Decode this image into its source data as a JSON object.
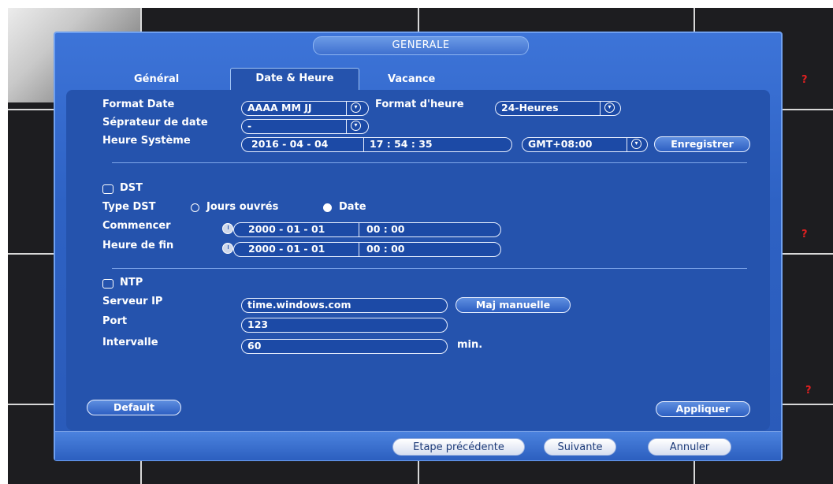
{
  "dialog": {
    "title": "GENERALE"
  },
  "tabs": [
    {
      "label": "Général"
    },
    {
      "label": "Date & Heure"
    },
    {
      "label": "Vacance"
    }
  ],
  "date_format": {
    "label": "Format Date",
    "value": "AAAA MM JJ"
  },
  "time_format": {
    "label": "Format d'heure",
    "value": "24-Heures"
  },
  "date_separator": {
    "label": "Séprateur de date",
    "value": "-"
  },
  "system_time": {
    "label": "Heure Système",
    "date": "2016 - 04 - 04",
    "time": "17 : 54 : 35",
    "timezone": "GMT+08:00",
    "save_label": "Enregistrer"
  },
  "dst": {
    "label": "DST",
    "type_label": "Type DST",
    "option_weekdays": "Jours ouvrés",
    "option_date": "Date",
    "selected": "Date",
    "start_label": "Commencer",
    "start_date": "2000 - 01 - 01",
    "start_time": "00 : 00",
    "end_label": "Heure de fin",
    "end_date": "2000 - 01 - 01",
    "end_time": "00 : 00"
  },
  "ntp": {
    "label": "NTP",
    "server_label": "Serveur IP",
    "server_value": "time.windows.com",
    "manual_update_label": "Maj manuelle",
    "port_label": "Port",
    "port_value": "123",
    "interval_label": "Intervalle",
    "interval_value": "60",
    "interval_unit": "min."
  },
  "actions": {
    "default_label": "Default",
    "apply_label": "Appliquer"
  },
  "footer": {
    "prev_label": "Etape précédente",
    "next_label": "Suivante",
    "cancel_label": "Annuler"
  },
  "background": {
    "help_mark": "?"
  },
  "colors": {
    "dialog_blue": "#2e62c4",
    "panel_blue": "#2553ad",
    "help_red": "#e02020"
  }
}
